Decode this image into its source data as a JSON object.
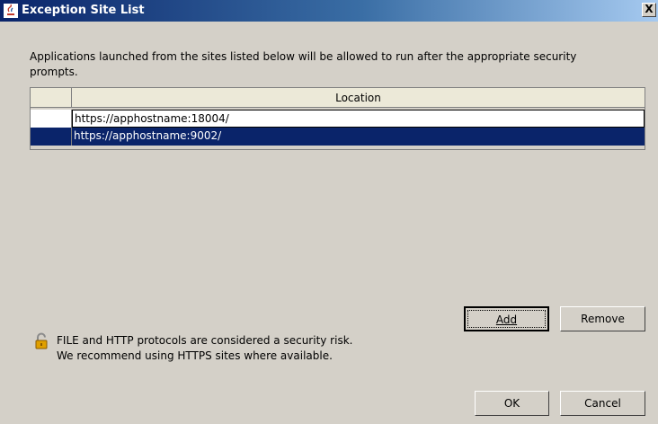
{
  "window": {
    "title": "Exception Site List",
    "close_label": "X"
  },
  "description": "Applications launched from the sites listed below will be allowed to run after the appropriate security prompts.",
  "table": {
    "columns": [
      "",
      "Location"
    ],
    "rows": [
      {
        "location": "https://apphostname:18004/",
        "selected": false,
        "editing": true
      },
      {
        "location": "https://apphostname:9002/",
        "selected": true,
        "editing": false
      }
    ]
  },
  "buttons": {
    "add": "Add",
    "remove": "Remove",
    "ok": "OK",
    "cancel": "Cancel"
  },
  "warning": {
    "icon": "lock-icon",
    "line1": "FILE and HTTP protocols are considered a security risk.",
    "line2": "We recommend using HTTPS sites where available."
  },
  "colors": {
    "titlebar_start": "#0a246a",
    "titlebar_end": "#a6caf0",
    "selection": "#0a246a",
    "window_bg": "#d4d0c8"
  }
}
